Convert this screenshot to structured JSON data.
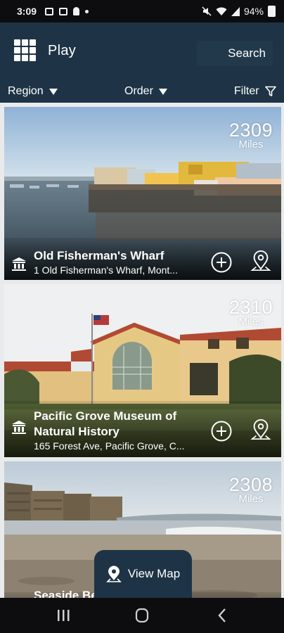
{
  "status_bar": {
    "time": "3:09",
    "battery": "94%"
  },
  "app_bar": {
    "title": "Play",
    "search_label": "Search"
  },
  "filters": {
    "region": "Region",
    "order": "Order",
    "filter": "Filter"
  },
  "places": [
    {
      "name": "Old Fisherman's Wharf",
      "address": "1 Old Fisherman's Wharf, Mont...",
      "distance": "2309",
      "unit": "Miles"
    },
    {
      "name": "Pacific Grove Museum of Natural History",
      "name_line1": "Pacific Grove Museum of",
      "name_line2": "Natural History",
      "address": "165 Forest Ave, Pacific Grove, C...",
      "distance": "2310",
      "unit": "Miles"
    },
    {
      "name": "Seaside Be",
      "distance": "2308",
      "unit": "Miles"
    }
  ],
  "view_map_label": "View Map",
  "colors": {
    "header": "#1e3446",
    "list_background": "#e9eaec",
    "system_bar": "#0d0d0f"
  },
  "icons": [
    "grid-icon",
    "caret-down-icon",
    "filter-funnel-icon",
    "museum-icon",
    "add-circle-icon",
    "map-pin-icon",
    "back-icon",
    "home-icon",
    "recents-icon"
  ]
}
